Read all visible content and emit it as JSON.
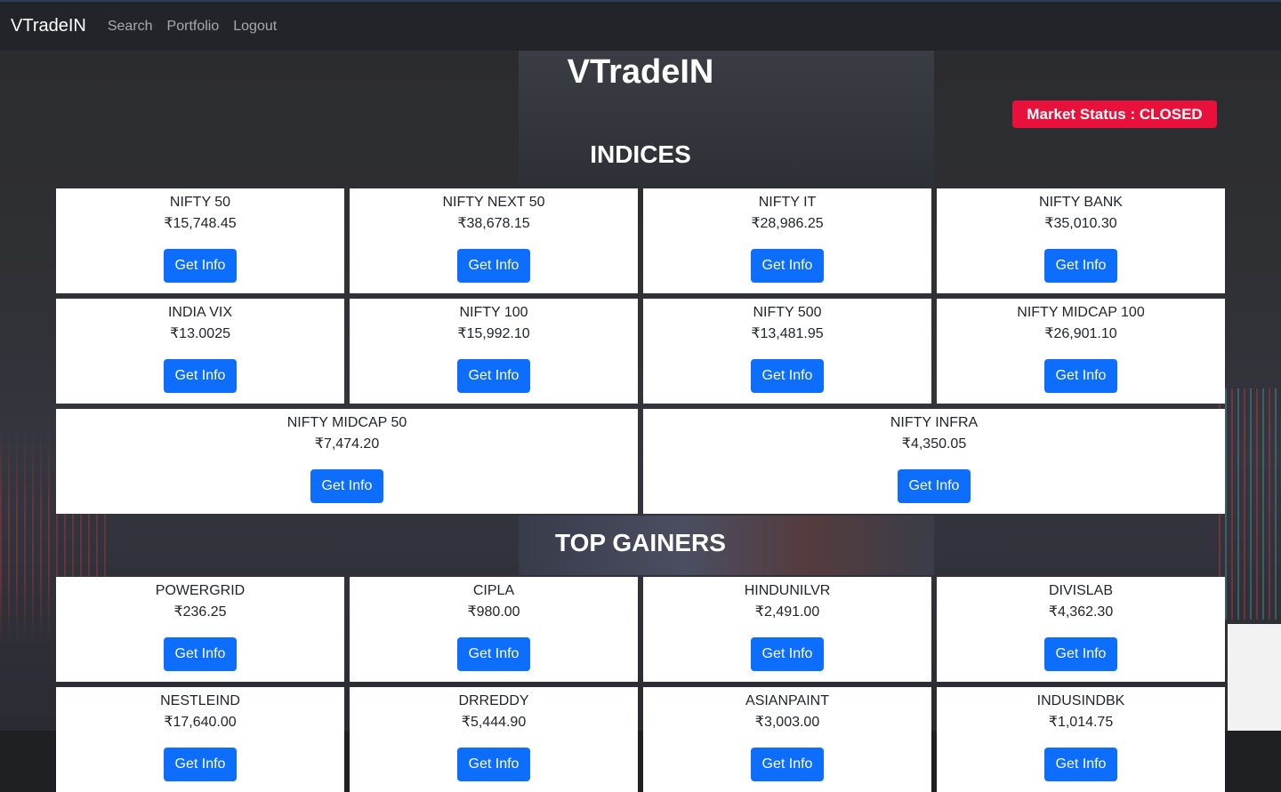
{
  "navbar": {
    "brand": "VTradeIN",
    "links": [
      "Search",
      "Portfolio",
      "Logout"
    ]
  },
  "site_title": "VTradeIN",
  "market_status": "Market Status : CLOSED",
  "sections": {
    "indices": {
      "title": "INDICES",
      "items": [
        {
          "name": "NIFTY 50",
          "price": "₹15,748.45"
        },
        {
          "name": "NIFTY NEXT 50",
          "price": "₹38,678.15"
        },
        {
          "name": "NIFTY IT",
          "price": "₹28,986.25"
        },
        {
          "name": "NIFTY BANK",
          "price": "₹35,010.30"
        },
        {
          "name": "INDIA VIX",
          "price": "₹13.0025"
        },
        {
          "name": "NIFTY 100",
          "price": "₹15,992.10"
        },
        {
          "name": "NIFTY 500",
          "price": "₹13,481.95"
        },
        {
          "name": "NIFTY MIDCAP 100",
          "price": "₹26,901.10"
        },
        {
          "name": "NIFTY MIDCAP 50",
          "price": "₹7,474.20"
        },
        {
          "name": "NIFTY INFRA",
          "price": "₹4,350.05"
        }
      ]
    },
    "top_gainers": {
      "title": "TOP GAINERS",
      "items": [
        {
          "name": "POWERGRID",
          "price": "₹236.25"
        },
        {
          "name": "CIPLA",
          "price": "₹980.00"
        },
        {
          "name": "HINDUNILVR",
          "price": "₹2,491.00"
        },
        {
          "name": "DIVISLAB",
          "price": "₹4,362.30"
        },
        {
          "name": "NESTLEIND",
          "price": "₹17,640.00"
        },
        {
          "name": "DRREDDY",
          "price": "₹5,444.90"
        },
        {
          "name": "ASIANPAINT",
          "price": "₹3,003.00"
        },
        {
          "name": "INDUSINDBK",
          "price": "₹1,014.75"
        }
      ]
    }
  },
  "button_label": "Get Info",
  "colors": {
    "navbar_bg": "#212529",
    "primary_button": "#0d6efd",
    "status_badge": "#e8113b"
  }
}
